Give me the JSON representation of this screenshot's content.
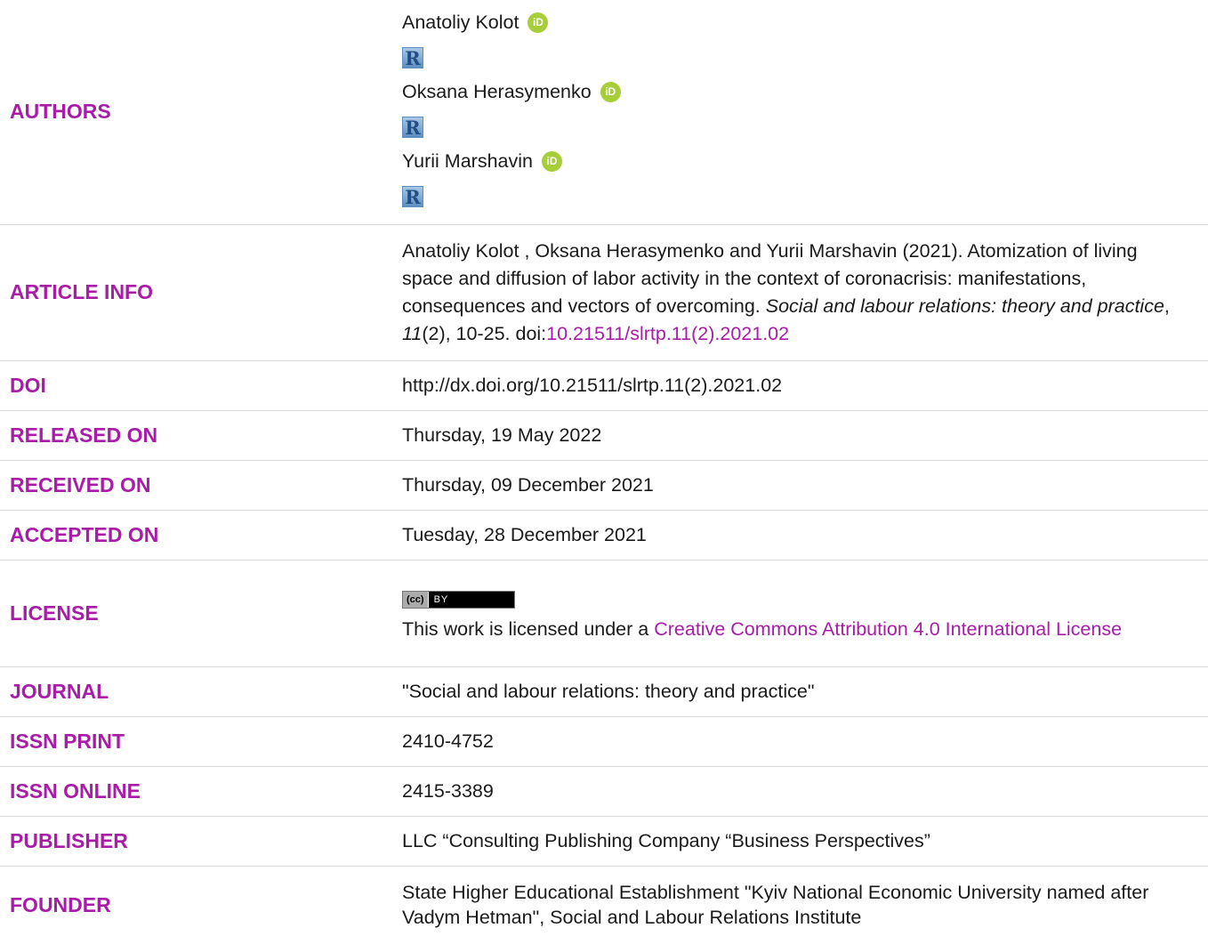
{
  "authors": {
    "label": "AUTHORS",
    "list": [
      "Anatoliy Kolot",
      "Oksana Herasymenko",
      "Yurii Marshavin"
    ],
    "orcid_glyph": "iD",
    "r_glyph": "R"
  },
  "article_info": {
    "label": "ARTICLE INFO",
    "citation_text": "Anatoliy Kolot , Oksana Herasymenko and Yurii Marshavin (2021). Atomization of living space and diffusion of labor activity in the context of coronacrisis: manifestations, consequences and vectors of overcoming. ",
    "journal_italic": "Social and labour relations: theory and practice",
    "sep1": ", ",
    "volume_italic": "11",
    "issue_pages": "(2), 10-25. doi:",
    "doi_link": "10.21511/slrtp.11(2).2021.02"
  },
  "doi": {
    "label": "DOI",
    "value": "http://dx.doi.org/10.21511/slrtp.11(2).2021.02"
  },
  "released": {
    "label": "RELEASED ON",
    "value": "Thursday, 19 May 2022"
  },
  "received": {
    "label": "RECEIVED ON",
    "value": "Thursday, 09 December 2021"
  },
  "accepted": {
    "label": "ACCEPTED ON",
    "value": "Tuesday, 28 December 2021"
  },
  "license": {
    "label": "LICENSE",
    "badge_cc": "(cc)",
    "badge_by": "BY",
    "text_prefix": "This work is licensed under a ",
    "link_text": "Creative Commons Attribution 4.0 International License"
  },
  "journal": {
    "label": "JOURNAL",
    "value": "\"Social and labour relations: theory and practice\""
  },
  "issn_print": {
    "label": "ISSN PRINT",
    "value": "2410-4752"
  },
  "issn_online": {
    "label": "ISSN ONLINE",
    "value": "2415-3389"
  },
  "publisher": {
    "label": "PUBLISHER",
    "value": "LLC “Consulting Publishing Company “Business Perspectives”"
  },
  "founder": {
    "label": "FOUNDER",
    "value": "State Higher Educational Establishment \"Kyiv National Economic University named after Vadym Hetman\", Social and Labour Relations Institute"
  },
  "colors": {
    "label": "#a81ca8",
    "orcid": "#a6ce39",
    "rule": "#d9d9d9"
  }
}
